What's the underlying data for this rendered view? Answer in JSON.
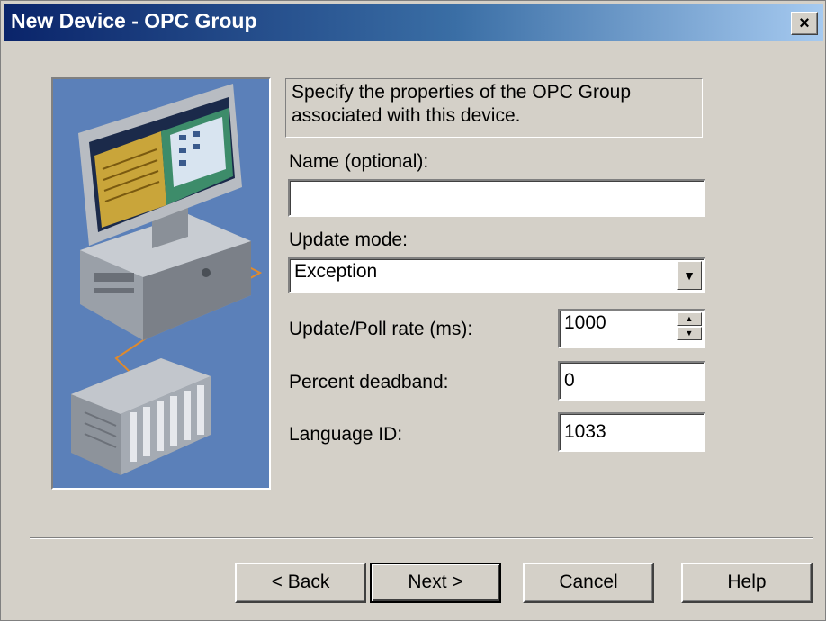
{
  "window": {
    "title": "New Device - OPC Group",
    "close_glyph": "×"
  },
  "description": "Specify the properties of the OPC Group associated with this device.",
  "fields": {
    "name": {
      "label": "Name (optional):",
      "value": ""
    },
    "update_mode": {
      "label": "Update mode:",
      "value": "Exception"
    },
    "update_rate": {
      "label": "Update/Poll rate (ms):",
      "value": "1000"
    },
    "deadband": {
      "label": "Percent deadband:",
      "value": "0"
    },
    "language": {
      "label": "Language ID:",
      "value": "1033"
    }
  },
  "buttons": {
    "back": "< Back",
    "next": "Next >",
    "cancel": "Cancel",
    "help": "Help"
  },
  "icons": {
    "dropdown": "chevron-down-icon",
    "spin_up": "spin-up-icon",
    "spin_down": "spin-down-icon",
    "close": "close-icon"
  },
  "colors": {
    "title_start": "#0a246a",
    "title_end": "#a6caf0",
    "dialog_bg": "#d4d0c8",
    "illustration_bg": "#5a7fb8"
  }
}
